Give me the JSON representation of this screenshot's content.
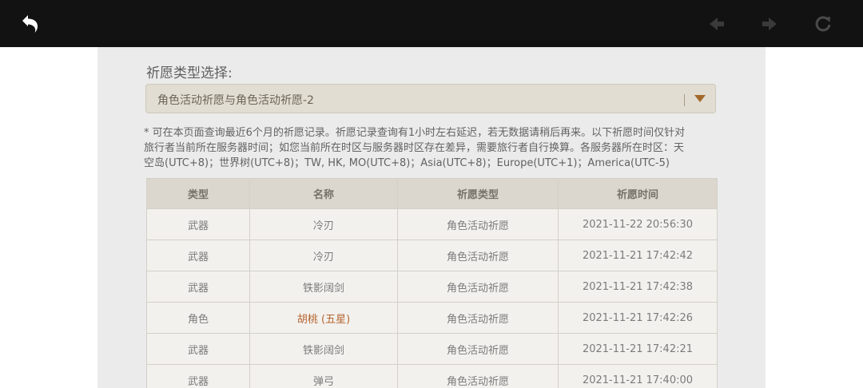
{
  "colors": {
    "topbar": "#121212",
    "panel": "#ebebeb",
    "five_star": "#b7652f"
  },
  "toolbar": {
    "back_icon": "undo-arrow-icon",
    "prev_icon": "prev-arrow-icon",
    "next_icon": "next-arrow-icon",
    "refresh_icon": "refresh-icon"
  },
  "filter": {
    "label": "祈愿类型选择:",
    "selected": "角色活动祈愿与角色活动祈愿-2"
  },
  "notice": {
    "line1": "* 可在本页面查询最近6个月的祈愿记录。祈愿记录查询有1小时左右延迟，若无数据请稍后再来。以下祈愿时间仅针对",
    "line2": "旅行者当前所在服务器时间；如您当前所在时区与服务器时区存在差异，需要旅行者自行换算。各服务器所在时区：天",
    "line3": "空岛(UTC+8)；世界树(UTC+8)；TW, HK, MO(UTC+8)；Asia(UTC+8)；Europe(UTC+1)；America(UTC-5)"
  },
  "table": {
    "headers": [
      "类型",
      "名称",
      "祈愿类型",
      "祈愿时间"
    ],
    "rows": [
      {
        "type": "武器",
        "name": "冷刃",
        "wish_type": "角色活动祈愿",
        "time": "2021-11-22 20:56:30",
        "five_star": false
      },
      {
        "type": "武器",
        "name": "冷刃",
        "wish_type": "角色活动祈愿",
        "time": "2021-11-21 17:42:42",
        "five_star": false
      },
      {
        "type": "武器",
        "name": "铁影阔剑",
        "wish_type": "角色活动祈愿",
        "time": "2021-11-21 17:42:38",
        "five_star": false
      },
      {
        "type": "角色",
        "name": "胡桃 (五星)",
        "wish_type": "角色活动祈愿",
        "time": "2021-11-21 17:42:26",
        "five_star": true
      },
      {
        "type": "武器",
        "name": "铁影阔剑",
        "wish_type": "角色活动祈愿",
        "time": "2021-11-21 17:42:21",
        "five_star": false
      },
      {
        "type": "武器",
        "name": "弹弓",
        "wish_type": "角色活动祈愿",
        "time": "2021-11-21 17:40:00",
        "five_star": false
      }
    ]
  }
}
